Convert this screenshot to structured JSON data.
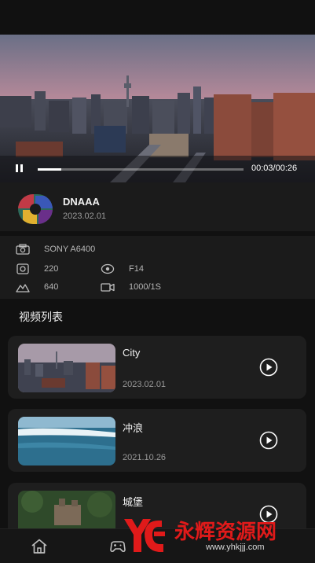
{
  "player": {
    "current_time": "00:03",
    "duration": "00:26",
    "time_display": "00:03/00:26",
    "progress": 0.115
  },
  "author": {
    "name": "DNAAA",
    "date": "2023.02.01"
  },
  "metadata": {
    "camera": "SONY A6400",
    "iso": "220",
    "aperture": "F14",
    "focal": "640",
    "shutter": "1000/1S"
  },
  "section": {
    "title": "视频列表"
  },
  "videos": [
    {
      "title": "City",
      "date": "2023.02.01",
      "thumb": "city-skyline"
    },
    {
      "title": "冲浪",
      "date": "2021.10.26",
      "thumb": "ocean-wave"
    },
    {
      "title": "城堡",
      "date": "",
      "thumb": "castle"
    }
  ],
  "tabbar": {
    "items": [
      {
        "icon": "home-icon"
      },
      {
        "icon": "gamepad-icon"
      }
    ]
  },
  "watermark": {
    "text": "永辉资源网",
    "url": "www.yhkjjj.com"
  },
  "colors": {
    "background": "#111111",
    "panel": "#1b1b1b",
    "card": "#1e1e1e",
    "accent_text": "#ffffff",
    "muted_text": "#9a9a9a",
    "watermark_red": "#e01a1a"
  }
}
